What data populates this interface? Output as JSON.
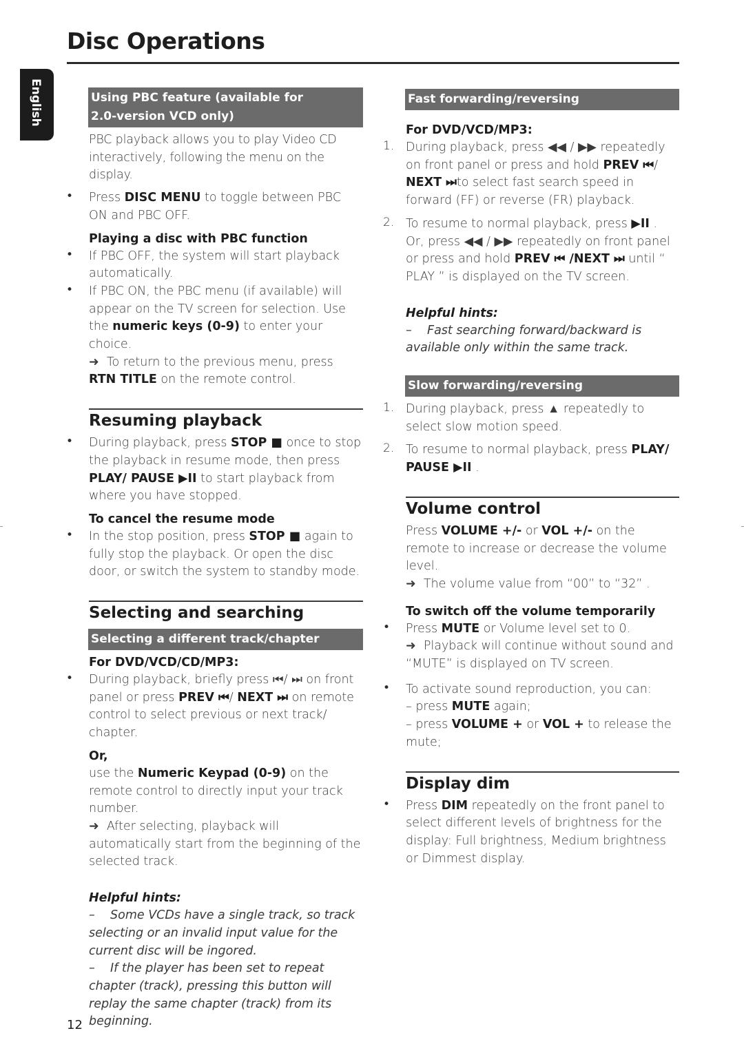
{
  "page": {
    "title": "Disc Operations",
    "language_tab": "English",
    "page_number": "12"
  },
  "left": {
    "pbc_bar": [
      "Using PBC feature (available for",
      "2.0-version VCD only)"
    ],
    "pbc_intro": "PBC playback allows you to play Video CD interactively, following the menu on the display.",
    "pbc_bullet1": {
      "pre": "Press ",
      "bold": "DISC MENU",
      "post": " to toggle between PBC ON and PBC OFF."
    },
    "pbc_sub": "Playing a disc with PBC function",
    "pbc_bullet2": "If PBC OFF, the system will start playback automatically.",
    "pbc_bullet3": {
      "pre": "If PBC ON, the PBC menu (if available) will appear on the TV screen for selection. Use the ",
      "bold": "numeric keys (0-9)",
      "post": " to enter your choice."
    },
    "pbc_arrow": {
      "pre": "To return to the previous menu, press ",
      "bold": "RTN TITLE",
      "post": " on the remote control."
    },
    "resume_heading": "Resuming playback",
    "resume_bullet": {
      "t1": "During playback, press ",
      "b1": "STOP ■",
      "t2": " once to stop the playback in resume mode, then press ",
      "b2": "PLAY/ PAUSE ▶II",
      "t3": " to start playback from where you have stopped."
    },
    "cancel_sub": "To cancel the resume mode",
    "cancel_bullet": {
      "t1": "In the stop position, press ",
      "b1": "STOP ■",
      "t2": " again to fully stop the playback. Or open the disc door, or switch the system to standby mode."
    },
    "select_heading": "Selecting and searching",
    "select_bar": "Selecting a different track/chapter",
    "select_sub": "For DVD/VCD/CD/MP3:",
    "select_bullet": {
      "t1": "During playback, briefly press ⏮/ ⏭ on front panel or press ",
      "b1": "PREV ⏮",
      "t2": "/ ",
      "b2": "NEXT ⏭",
      "t3": " on remote control to select previous or next track/ chapter."
    },
    "or_label": "Or,",
    "keypad_text": {
      "t1": "use the ",
      "b1": "Numeric Keypad (0-9)",
      "t2": " on the remote control to directly input your track number."
    },
    "keypad_arrow": "After selecting, playback will automatically start from the beginning of the selected track.",
    "hints_title": "Helpful hints:",
    "hint1": "Some VCDs have a single track,  so track selecting or an invalid input value for the current disc will be ingored.",
    "hint2": "If the player has been set to repeat chapter (track), pressing this button will replay the same chapter (track) from its beginning."
  },
  "right": {
    "fast_bar": "Fast forwarding/reversing",
    "fast_sub": "For DVD/VCD/MP3:",
    "fast_step1": {
      "t1": "During playback, press ◀◀ / ▶▶  repeatedly on front panel or press and hold ",
      "b1": "PREV ⏮",
      "t2": "/ ",
      "b2": "NEXT ⏭",
      "t3": "to select fast search speed in forward (FF) or reverse (FR) playback."
    },
    "fast_step2": {
      "t1": "To resume to normal playback, press ",
      "b1": "▶II",
      "t2": " . Or, press ◀◀ / ▶▶ repeatedly on front panel or press and hold ",
      "b2": "PREV ⏮ /NEXT ⏭",
      "t3": " until “ PLAY ” is displayed on the TV screen."
    },
    "hints_title": "Helpful hints:",
    "fast_hint": "Fast searching forward/backward is available only within the same track.",
    "slow_bar": "Slow forwarding/reversing",
    "slow_step1": "During playback, press ▲ repeatedly to select slow motion speed.",
    "slow_step2": {
      "t1": "To resume to normal playback, press ",
      "b1": "PLAY/ PAUSE ▶II",
      "t2": " ."
    },
    "volume_heading": "Volume control",
    "volume_text": {
      "t1": "Press ",
      "b1": "VOLUME +/-",
      "t2": " or ",
      "b2": "VOL +/-",
      "t3": " on the remote to increase or decrease the volume level."
    },
    "volume_arrow": "The volume value from “00” to “32” .",
    "mute_sub": "To switch off the volume temporarily",
    "mute_bullet": {
      "t1": "Press ",
      "b1": "MUTE",
      "t2": " or Volume level set to 0."
    },
    "mute_arrow": "Playback will continue without sound and “MUTE” is displayed on TV screen.",
    "activate_bullet": "To activate sound reproduction, you can:",
    "activate_line1": {
      "t1": "– press ",
      "b1": "MUTE",
      "t2": " again;"
    },
    "activate_line2": {
      "t1": "– press ",
      "b1": "VOLUME +",
      "t2": " or ",
      "b2": "VOL +",
      "t3": " to release the mute;"
    },
    "dim_heading": "Display dim",
    "dim_bullet": {
      "t1": "Press ",
      "b1": "DIM",
      "t2": " repeatedly on the front panel to select different levels of brightness for the display: Full brightness, Medium brightness or Dimmest display."
    }
  },
  "glyphs": {
    "bullet": "•",
    "arrow": "➜",
    "dash": "–",
    "num1": "1.",
    "num2": "2."
  }
}
